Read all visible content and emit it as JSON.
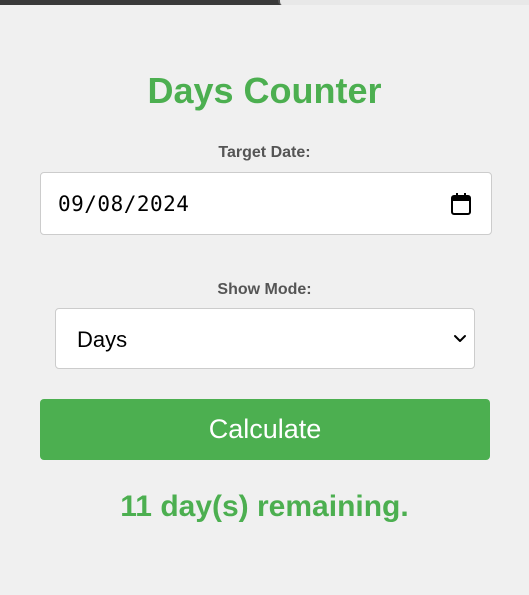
{
  "title": "Days Counter",
  "target_date": {
    "label": "Target Date:",
    "value": "09/08/2024"
  },
  "show_mode": {
    "label": "Show Mode:",
    "selected": "Days"
  },
  "calculate_label": "Calculate",
  "result_text": "11 day(s) remaining.",
  "colors": {
    "accent": "#4caf50",
    "label": "#555555",
    "background": "#f0f0f0"
  },
  "icons": {
    "date_picker": "calendar-icon",
    "select_arrow": "chevron-down-icon"
  }
}
